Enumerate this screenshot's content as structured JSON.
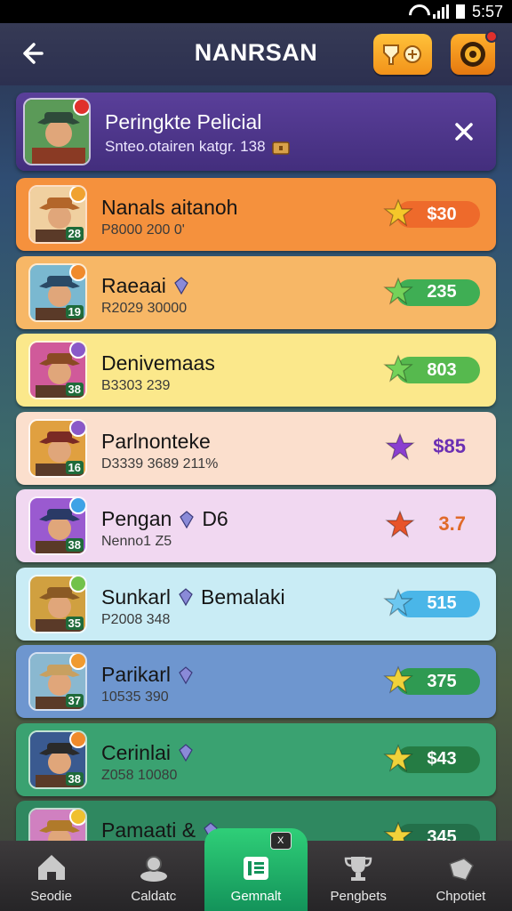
{
  "status_bar": {
    "time": "5:57"
  },
  "header": {
    "title": "NANRSAN",
    "back_icon": "arrow-left-icon",
    "rewards_icon": "rewards-icon",
    "record_icon": "record-icon"
  },
  "banner": {
    "title": "Peringkte Pelicial",
    "subtitle": "Snteo.otairen katgr. 138",
    "bg_color": "#4a3388"
  },
  "players": [
    {
      "name": "Nanals aitanoh",
      "extra": "",
      "sub": "P8000 200 0'",
      "score": "$30",
      "level": "28",
      "bg": "#f5913d",
      "pill": "#ee6a2b",
      "icon_color": "#f5c72a",
      "badge": "#f0a230"
    },
    {
      "name": "Raeaai",
      "extra": "",
      "sub": "R2029 30000",
      "score": "235",
      "level": "19",
      "bg": "#f7b766",
      "pill": "#3fae54",
      "icon_color": "#74d25a",
      "badge": "#f08a2c"
    },
    {
      "name": "Denivemaas",
      "extra": "",
      "sub": "B3303 239",
      "score": "803",
      "level": "38",
      "bg": "#fbe88b",
      "pill": "#56b94e",
      "icon_color": "#74d25a",
      "badge": "#8a59c8"
    },
    {
      "name": "Parlnonteke",
      "extra": "",
      "sub": "D3339 3689 211%",
      "score": "$85",
      "level": "16",
      "bg": "#fbdfcd",
      "pill": "",
      "icon_color": "#8a3fd0",
      "badge": "#8a59c8",
      "score_color": "#6b2fb3"
    },
    {
      "name": "Pengan",
      "extra": "D6",
      "sub": "Nenno1 Z5",
      "score": "3.7",
      "level": "38",
      "bg": "#f1d8f1",
      "pill": "",
      "icon_color": "#e8532a",
      "badge": "#3ea2e6",
      "score_color": "#e06a2a"
    },
    {
      "name": "Sunkarl",
      "extra": "Bemalaki",
      "sub": "P2008 348",
      "score": "515",
      "level": "35",
      "bg": "#c9ecf5",
      "pill": "#4ab6e8",
      "icon_color": "#6cc7f0",
      "badge": "#72c24a"
    },
    {
      "name": "Parikarl",
      "extra": "",
      "sub": "10535 390",
      "score": "375",
      "level": "37",
      "bg": "#6e96cf",
      "pill": "#2f9a52",
      "icon_color": "#f0d23a",
      "badge": "#f09a30"
    },
    {
      "name": "Cerinlai",
      "extra": "",
      "sub": "Z058 10080",
      "score": "$43",
      "level": "38",
      "bg": "#3aa271",
      "pill": "#257c44",
      "icon_color": "#f0d23a",
      "badge": "#f08a2c"
    },
    {
      "name": "Pamaati &",
      "extra": "",
      "sub": "",
      "score": "345",
      "level": "",
      "bg": "#2f8860",
      "pill": "#23704a",
      "icon_color": "#f0d23a",
      "badge": "#f0c030"
    }
  ],
  "nav": [
    {
      "label": "Seodie",
      "icon": "home-icon"
    },
    {
      "label": "Caldatc",
      "icon": "profile-icon"
    },
    {
      "label": "Gemnalt",
      "icon": "leaderboard-icon",
      "badge": "X"
    },
    {
      "label": "Pengbets",
      "icon": "trophy-icon"
    },
    {
      "label": "Chpotiet",
      "icon": "whistle-icon"
    }
  ]
}
